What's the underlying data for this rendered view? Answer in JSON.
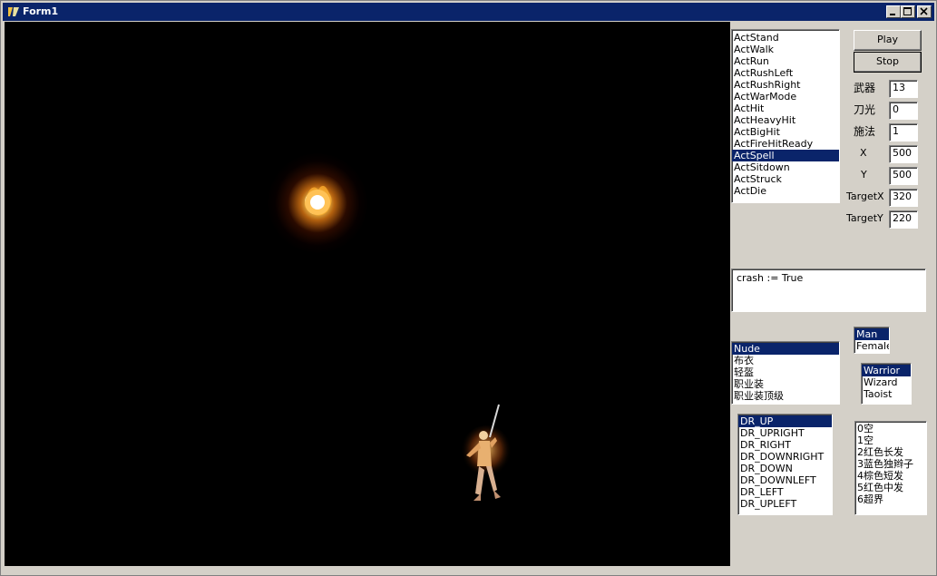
{
  "window": {
    "title": "Form1"
  },
  "titlebar": {
    "minimize_label": "_",
    "maximize_label": "□",
    "close_label": "×"
  },
  "actions": {
    "items": [
      "ActStand",
      "ActWalk",
      "ActRun",
      "ActRushLeft",
      "ActRushRight",
      "ActWarMode",
      "ActHit",
      "ActHeavyHit",
      "ActBigHit",
      "ActFireHitReady",
      "ActSpell",
      "ActSitdown",
      "ActStruck",
      "ActDie"
    ],
    "selected_index": 10
  },
  "buttons": {
    "play": "Play",
    "stop": "Stop"
  },
  "params": [
    {
      "label": "武器",
      "value": "13"
    },
    {
      "label": "刀光",
      "value": "0"
    },
    {
      "label": "施法",
      "value": "1"
    },
    {
      "label": "X",
      "value": "500"
    },
    {
      "label": "Y",
      "value": "500"
    },
    {
      "label": "TargetX",
      "value": "320"
    },
    {
      "label": "TargetY",
      "value": "220"
    }
  ],
  "log": {
    "text": "crash := True"
  },
  "gender": {
    "items": [
      "Man",
      "Female"
    ],
    "selected_index": 0
  },
  "armor": {
    "items": [
      "Nude",
      "布衣",
      "轻盔",
      "职业装",
      "职业装顶级"
    ],
    "selected_index": 0
  },
  "job": {
    "items": [
      "Warrior",
      "Wizard",
      "Taoist"
    ],
    "selected_index": 0
  },
  "directions": {
    "items": [
      "DR_UP",
      "DR_UPRIGHT",
      "DR_RIGHT",
      "DR_DOWNRIGHT",
      "DR_DOWN",
      "DR_DOWNLEFT",
      "DR_LEFT",
      "DR_UPLEFT"
    ],
    "selected_index": 0
  },
  "hair": {
    "items": [
      "0空",
      "1空",
      "2红色长发",
      "3蓝色独辫子",
      "4棕色短发",
      "5红色中发",
      "6超界"
    ]
  },
  "icons": {
    "app": "delphi-app-icon",
    "fireball": "fireball-sprite",
    "character": "warrior-sprite"
  },
  "colors": {
    "selection": "#0a246a",
    "titlebar": "#0a246a",
    "canvas": "#000000",
    "face": "#d4d0c8"
  }
}
